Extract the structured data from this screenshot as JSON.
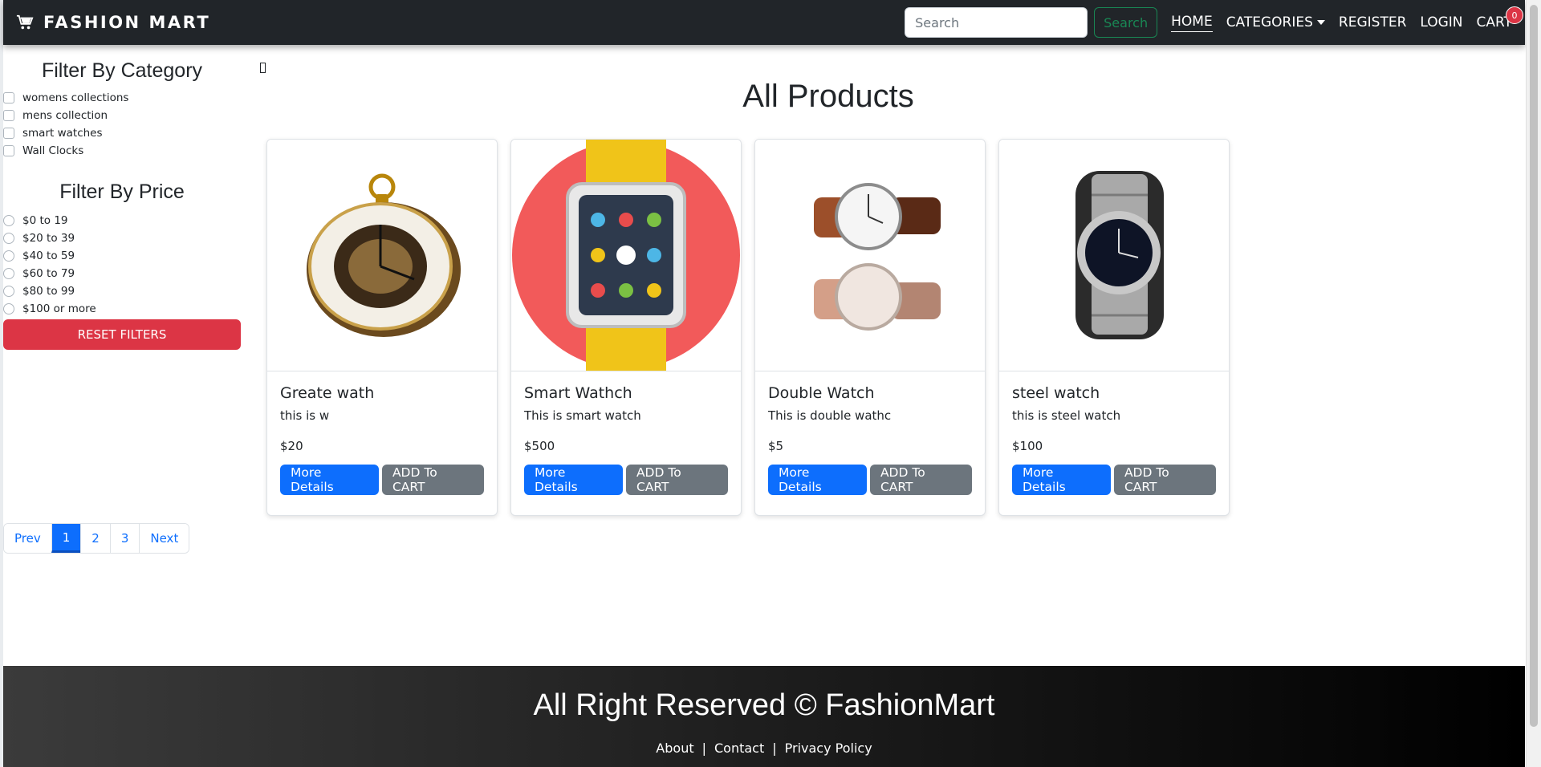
{
  "navbar": {
    "brand": "FASHION MART",
    "search_placeholder": "Search",
    "search_button": "Search",
    "links": {
      "home": "HOME",
      "categories": "CATEGORIES",
      "register": "REGISTER",
      "login": "LOGIN",
      "cart": "CART"
    },
    "cart_count": "0"
  },
  "sidebar": {
    "category_heading": "Filter By Category",
    "categories": [
      "womens collections",
      "mens collection",
      "smart watches",
      "Wall Clocks"
    ],
    "price_heading": "Filter By Price",
    "prices": [
      "$0 to 19",
      "$20 to 39",
      "$40 to 59",
      "$60 to 79",
      "$80 to 99",
      "$100 or more"
    ],
    "reset_button": "RESET FILTERS"
  },
  "main": {
    "heading": "All Products",
    "products": [
      {
        "name": "Greate wath",
        "description": "this is w",
        "price": "$20",
        "image": "pocket-watch-image"
      },
      {
        "name": "Smart Wathch",
        "description": "This is smart watch",
        "price": "$500",
        "image": "smartwatch-image"
      },
      {
        "name": "Double Watch",
        "description": "This is double wathc",
        "price": "$5",
        "image": "leather-watch-image"
      },
      {
        "name": "steel watch",
        "description": "this is steel watch",
        "price": "$100",
        "image": "steel-watch-image"
      }
    ],
    "details_button": "More Details",
    "cart_button": "ADD To CART"
  },
  "pagination": {
    "prev": "Prev",
    "pages": [
      "1",
      "2",
      "3"
    ],
    "active": "1",
    "next": "Next"
  },
  "footer": {
    "title": "All Right Reserved © FashionMart",
    "links": [
      "About",
      "Contact",
      "Privacy Policy"
    ]
  },
  "colors": {
    "navbar": "#212529",
    "primary": "#0d6efd",
    "danger": "#dc3545",
    "secondary": "#6c757d",
    "success": "#198754"
  }
}
